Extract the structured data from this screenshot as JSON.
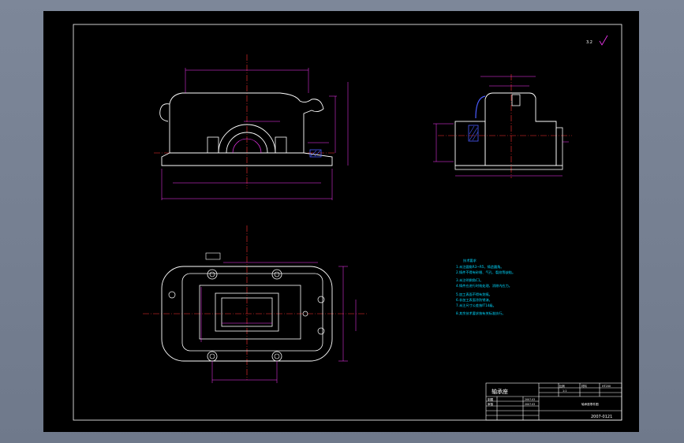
{
  "colors": {
    "background": "#6f798b",
    "canvas": "#000000",
    "outline": "#ffffff",
    "dimension": "#ff38ff",
    "centerline": "#ff3030",
    "hatch": "#4a5cff",
    "note": "#00d7ff"
  },
  "header": {
    "roughness_symbol": "3.2"
  },
  "technical_requirements": {
    "title": "技术要求",
    "lines": [
      "1.未注圆角R3~R5，铸造圆角。",
      "2.铸件不得有砂眼、气孔、裂纹等缺陷。",
      "3.未注明倒角C1。",
      "4.铸件应进行时效处理，消除内应力。",
      "5.加工表面不得有划痕。",
      "6.非加工表面涂防锈漆。",
      "7.未注尺寸公差按IT14级。",
      "8.其余技术要求按有关标准执行。"
    ]
  },
  "title_block": {
    "part_name": "轴承座",
    "scale_label": "比例",
    "scale_value": "1:1",
    "material_label": "材料",
    "material_value": "HT200",
    "drawn_label": "制图",
    "checked_label": "审核",
    "date1": "2007.03",
    "date2": "2007.03",
    "company": "轴承座零件图",
    "drawing_number": "2007-0121"
  }
}
